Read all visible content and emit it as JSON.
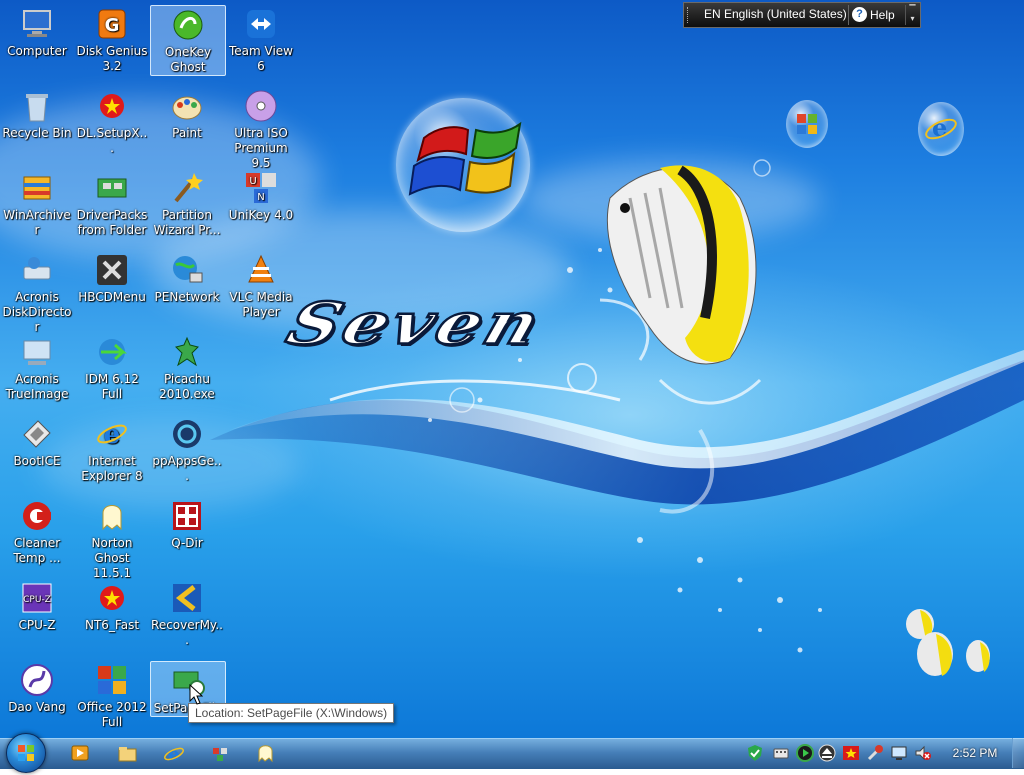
{
  "desktop": {
    "icons": [
      {
        "id": "computer",
        "label": "Computer",
        "icon": "computer-icon",
        "selected": false
      },
      {
        "id": "disk-genius",
        "label": "Disk Genius 3.2",
        "icon": "disk-genius-icon",
        "selected": false
      },
      {
        "id": "onekey-ghost",
        "label": "OneKey Ghost",
        "icon": "onekey-ghost-icon",
        "selected": true
      },
      {
        "id": "team-view",
        "label": "Team View 6",
        "icon": "teamviewer-icon",
        "selected": false
      },
      {
        "id": "recycle-bin",
        "label": "Recycle Bin",
        "icon": "recycle-bin-icon",
        "selected": false
      },
      {
        "id": "dl-setup",
        "label": "DL.SetupX...",
        "icon": "vietnam-star-icon",
        "selected": false
      },
      {
        "id": "paint",
        "label": "Paint",
        "icon": "paint-palette-icon",
        "selected": false
      },
      {
        "id": "ultra-iso",
        "label": "Ultra ISO Premium 9.5",
        "icon": "disc-icon",
        "selected": false
      },
      {
        "id": "winarchiver",
        "label": "WinArchiver",
        "icon": "archive-icon",
        "selected": false
      },
      {
        "id": "driverpacks",
        "label": "DriverPacks from Folder",
        "icon": "driver-board-icon",
        "selected": false
      },
      {
        "id": "partition-wizard",
        "label": "Partition Wizard Pr...",
        "icon": "wizard-icon",
        "selected": false
      },
      {
        "id": "unikey",
        "label": "UniKey 4.0",
        "icon": "unikey-icon",
        "selected": false
      },
      {
        "id": "acronis-dd",
        "label": "Acronis DiskDirector",
        "icon": "acronis-icon",
        "selected": false
      },
      {
        "id": "hbcd-menu",
        "label": "HBCDMenu",
        "icon": "tools-icon",
        "selected": false
      },
      {
        "id": "penetwork",
        "label": "PENetwork",
        "icon": "globe-network-icon",
        "selected": false
      },
      {
        "id": "vlc",
        "label": "VLC Media Player",
        "icon": "vlc-cone-icon",
        "selected": false
      },
      {
        "id": "acronis-ti",
        "label": "Acronis TrueImage",
        "icon": "acronis-icon",
        "selected": false
      },
      {
        "id": "idm",
        "label": "IDM 6.12 Full",
        "icon": "idm-globe-icon",
        "selected": false
      },
      {
        "id": "picachu",
        "label": "Picachu 2010.exe",
        "icon": "dragon-icon",
        "selected": false
      },
      {
        "id": "bootice",
        "label": "BootICE",
        "icon": "bootice-icon",
        "selected": false
      },
      {
        "id": "ie8",
        "label": "Internet Explorer 8",
        "icon": "internet-explorer-icon",
        "selected": false
      },
      {
        "id": "ppapps",
        "label": "ppAppsGe...",
        "icon": "ppapps-icon",
        "selected": false
      },
      {
        "id": "cleaner",
        "label": "Cleaner Temp ...",
        "icon": "ccleaner-icon",
        "selected": false
      },
      {
        "id": "norton-ghost",
        "label": "Norton Ghost 11.5.1",
        "icon": "ghost-icon",
        "selected": false
      },
      {
        "id": "q-dir",
        "label": "Q-Dir",
        "icon": "q-dir-icon",
        "selected": false
      },
      {
        "id": "cpu-z",
        "label": "CPU-Z",
        "icon": "cpu-z-icon",
        "selected": false
      },
      {
        "id": "nt6-fast",
        "label": "NT6_Fast",
        "icon": "vietnam-star-icon",
        "selected": false
      },
      {
        "id": "recovermy",
        "label": "RecoverMy...",
        "icon": "recover-arrow-icon",
        "selected": false
      },
      {
        "id": "dao-vang",
        "label": "Dao Vang",
        "icon": "dao-vang-icon",
        "selected": false
      },
      {
        "id": "office-2012",
        "label": "Office 2012 Full",
        "icon": "office-icon",
        "selected": false
      },
      {
        "id": "setpagefile",
        "label": "SetPageFile",
        "icon": "setpagefile-icon",
        "selected": true
      }
    ]
  },
  "wallpaper": {
    "title": "Seven"
  },
  "language_bar": {
    "language": "EN English (United States)",
    "help": "Help"
  },
  "tooltip": {
    "text": "Location: SetPageFile (X:\\Windows)"
  },
  "taskbar": {
    "pinned": [
      "media-player-icon",
      "explorer-folder-icon",
      "internet-explorer-icon",
      "network-tool-icon",
      "ghost-icon"
    ],
    "tray": [
      "shield-check-icon",
      "keyboard-icon",
      "play-circle-icon",
      "eject-icon",
      "vietnam-star-icon",
      "tool-red-icon",
      "display-icon",
      "volume-muted-icon"
    ],
    "clock": "2:52 PM"
  }
}
